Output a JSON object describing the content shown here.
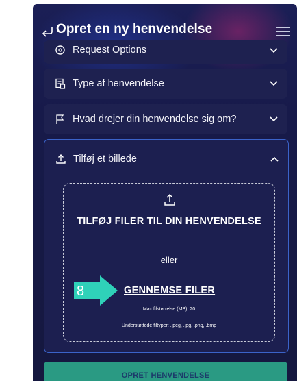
{
  "header": {
    "title": "Opret en ny henvendelse"
  },
  "sections": {
    "request_options": "Request Options",
    "type": "Type af henvendelse",
    "topic": "Hvad drejer din henvendelse sig om?",
    "attach": "Tilføj et billede"
  },
  "upload": {
    "title": "TILFØJ FILER TIL DIN HENVENDELSE",
    "or": "eller",
    "browse": "GENNEMSE FILER",
    "max_size": "Max filstørrelse (MB): 20",
    "types": "Understøttede filtyper: .jpeg, .jpg, .png, .bmp"
  },
  "marker": {
    "number": "8",
    "color": "#2fd1b9"
  },
  "submit": {
    "label": "OPRET HENVENDELSE"
  },
  "colors": {
    "background": "#171a4a",
    "card": "#1e2150",
    "accent_border": "#3b63c9",
    "submit": "#2a9a83"
  }
}
